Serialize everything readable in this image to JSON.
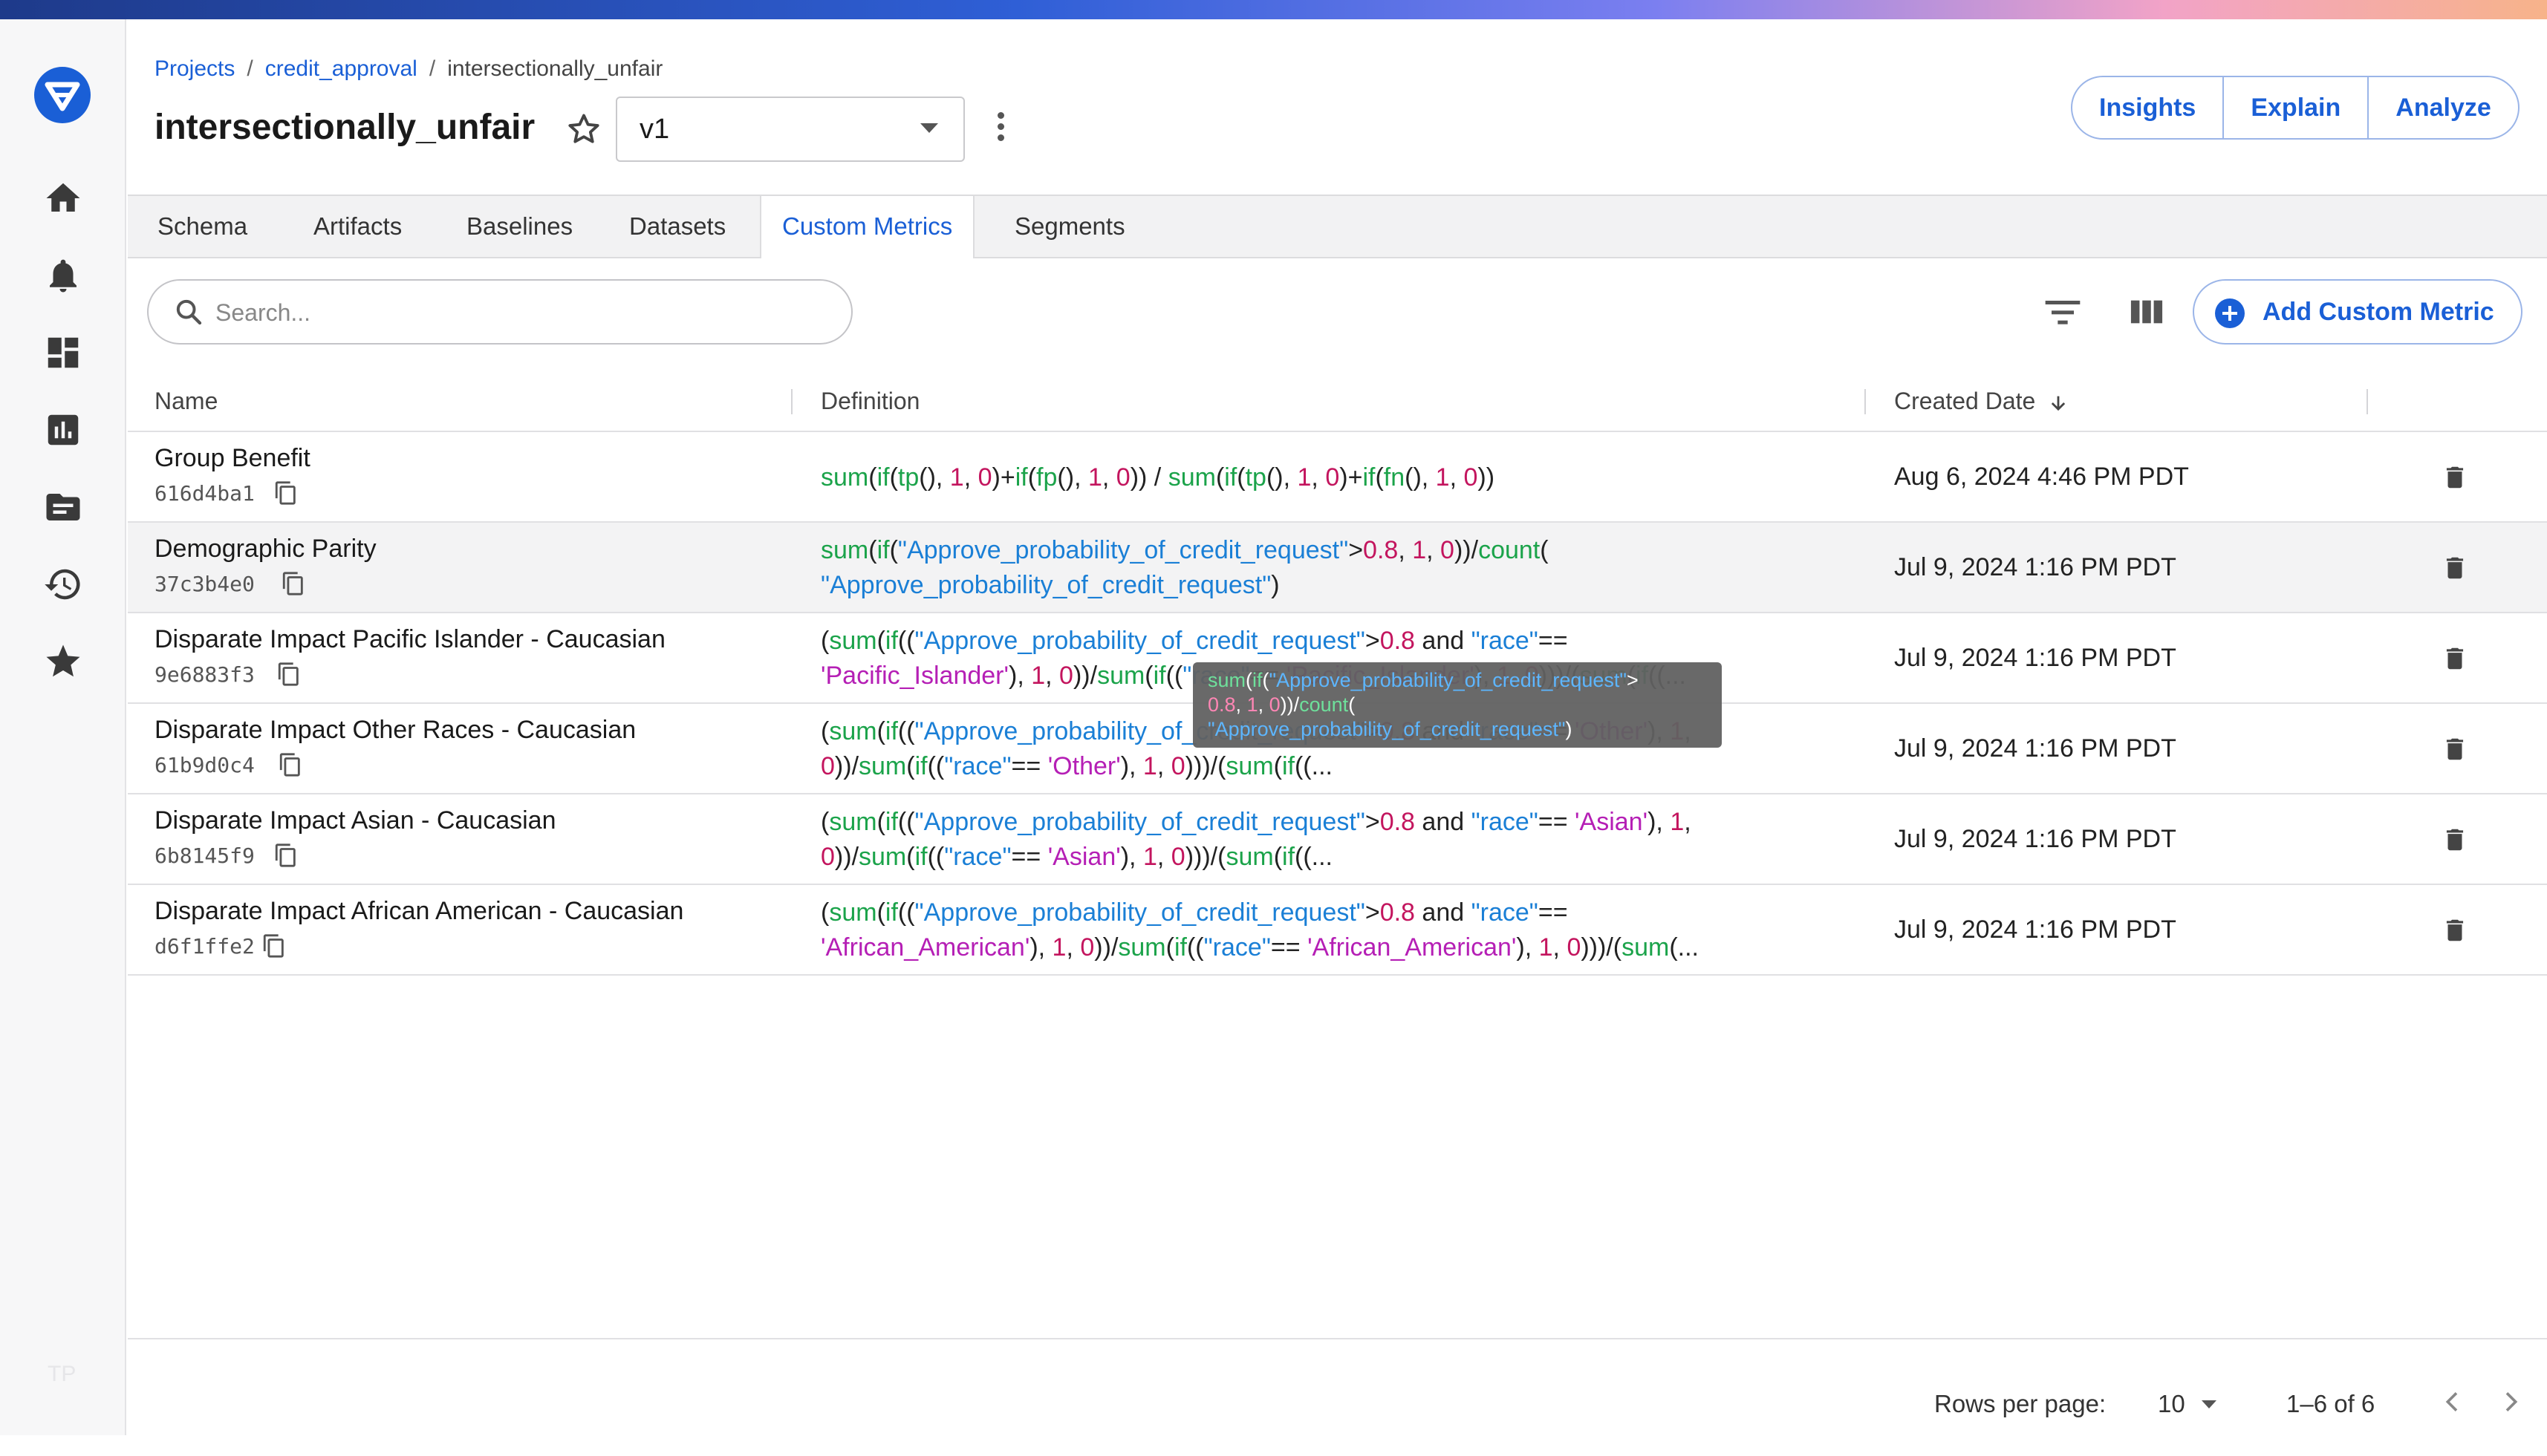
{
  "breadcrumb": {
    "projects": "Projects",
    "project": "credit_approval",
    "model": "intersectionally_unfair"
  },
  "header": {
    "title": "intersectionally_unfair",
    "version": "v1"
  },
  "actions": {
    "insights": "Insights",
    "explain": "Explain",
    "analyze": "Analyze"
  },
  "tabs": [
    "Schema",
    "Artifacts",
    "Baselines",
    "Datasets",
    "Custom Metrics",
    "Segments"
  ],
  "active_tab": "Custom Metrics",
  "search": {
    "placeholder": "Search..."
  },
  "add_button": "Add Custom Metric",
  "columns": {
    "name": "Name",
    "definition": "Definition",
    "created": "Created Date"
  },
  "rows": [
    {
      "name": "Group Benefit",
      "id": "616d4ba1",
      "created": "Aug 6, 2024 4:46 PM PDT",
      "definition": "sum(if(tp(), 1, 0)+if(fp(), 1, 0)) / sum(if(tp(), 1, 0)+if(fn(), 1, 0))"
    },
    {
      "name": "Demographic Parity",
      "id": "37c3b4e0",
      "created": "Jul 9, 2024 1:16 PM PDT",
      "definition": "sum(if(\"Approve_probability_of_credit_request\">0.8, 1, 0))/count( \"Approve_probability_of_credit_request\")"
    },
    {
      "name": "Disparate Impact Pacific Islander - Caucasian",
      "id": "9e6883f3",
      "created": "Jul 9, 2024 1:16 PM PDT",
      "definition": "(sum(if((\"Approve_probability_of_credit_request\">0.8 and \"race\"== 'Pacific_Islander'), 1, 0))/sum(if((\"race\"== 'Pacific_Islander'), 1, 0)))/(sum(if((..."
    },
    {
      "name": "Disparate Impact Other Races - Caucasian",
      "id": "61b9d0c4",
      "created": "Jul 9, 2024 1:16 PM PDT",
      "definition": "(sum(if((\"Approve_probability_of_credit_request\">0.8 and \"race\"== 'Other'), 1, 0))/sum(if((\"race\"== 'Other'), 1, 0)))/(sum(if((..."
    },
    {
      "name": "Disparate Impact Asian - Caucasian",
      "id": "6b8145f9",
      "created": "Jul 9, 2024 1:16 PM PDT",
      "definition": "(sum(if((\"Approve_probability_of_credit_request\">0.8 and \"race\"== 'Asian'), 1, 0))/sum(if((\"race\"== 'Asian'), 1, 0)))/(sum(if((..."
    },
    {
      "name": "Disparate Impact African American - Caucasian",
      "id": "d6f1ffe2",
      "created": "Jul 9, 2024 1:16 PM PDT",
      "definition": "(sum(if((\"Approve_probability_of_credit_request\">0.8 and \"race\"== 'African_American'), 1, 0))/sum(if((\"race\"== 'African_American'), 1, 0)))/(sum(..."
    }
  ],
  "tooltip": "sum(if(\"Approve_probability_of_credit_request\"> 0.8, 1, 0))/count( \"Approve_probability_of_credit_request\")",
  "pagination": {
    "rows_per_page_label": "Rows per page:",
    "rows_per_page": "10",
    "range": "1–6 of 6"
  },
  "sidebar": {
    "icons": [
      "home-icon",
      "bell-icon",
      "dashboard-icon",
      "chart-icon",
      "folder-icon",
      "history-icon",
      "star-icon"
    ],
    "footer": "TP"
  },
  "colors": {
    "accent": "#1a5fd6",
    "function": "#1ba34a",
    "string": "#1a7fd6",
    "number": "#c3155e",
    "literal": "#b51fb5"
  }
}
